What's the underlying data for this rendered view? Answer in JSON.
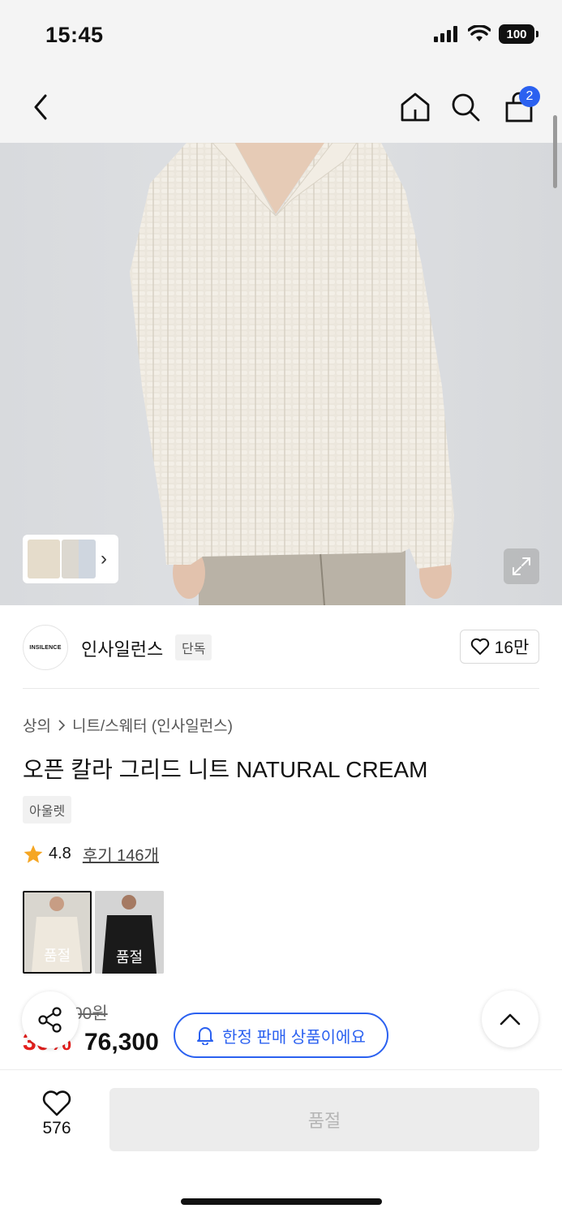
{
  "status_bar": {
    "time": "15:45",
    "battery": "100"
  },
  "nav": {
    "cart_count": "2",
    "icons": [
      "back-arrow-icon",
      "home-icon",
      "search-icon",
      "cart-icon"
    ]
  },
  "hero": {
    "thumbnails_more": "›"
  },
  "brand": {
    "logo_text": "INSILENCE",
    "name": "인사일런스",
    "tag": "단독",
    "likes": "16만"
  },
  "breadcrumb": {
    "category": "상의",
    "subcategory": "니트/스웨터 (인사일런스)"
  },
  "product": {
    "title": "오픈 칼라 그리드 니트 NATURAL CREAM",
    "tag": "아울렛",
    "rating": "4.8",
    "reviews": "후기 146개"
  },
  "variants": [
    {
      "label": "품절",
      "color": "#e4ddd0"
    },
    {
      "label": "품절",
      "color": "#1a1a1a"
    }
  ],
  "price": {
    "original_visible": "00원",
    "discount_visible": "30%",
    "sale_visible": "76,300"
  },
  "floating": {
    "limited_label": "한정 판매 상품이에요"
  },
  "bottom": {
    "wish_count": "576",
    "soldout_label": "품절"
  },
  "colors": {
    "accent": "#2b61f0",
    "discount": "#e5201e",
    "badge": "#2b61f0"
  }
}
